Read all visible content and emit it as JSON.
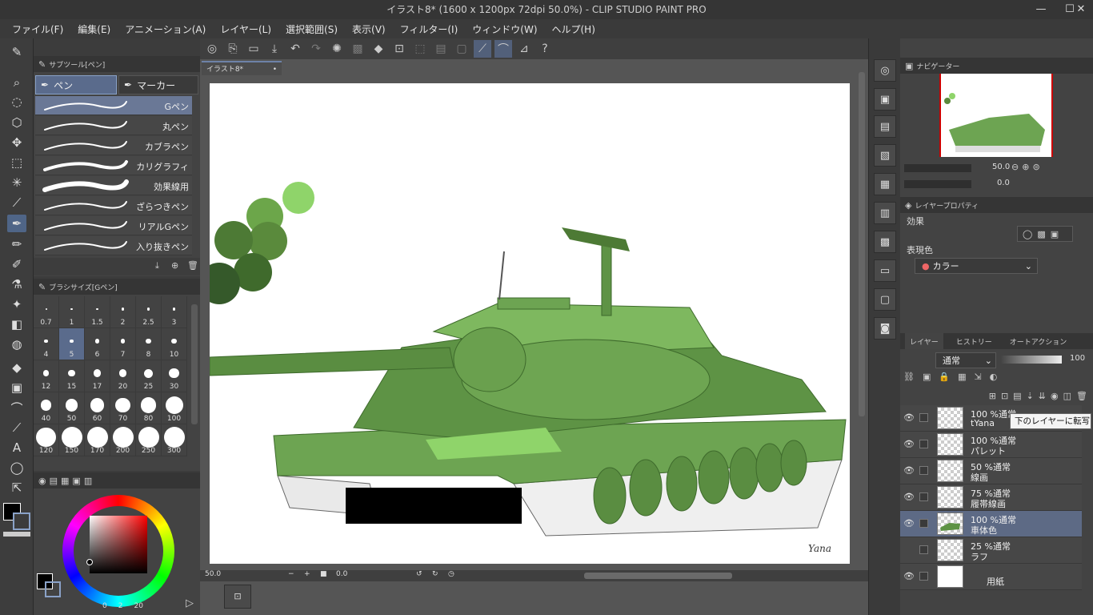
{
  "window": {
    "title": "イラスト8* (1600 x 1200px 72dpi 50.0%) - CLIP STUDIO PAINT PRO",
    "minimize_icon": "minimize-icon",
    "maximize_icon": "maximize-icon",
    "close_icon": "close-icon"
  },
  "menu": [
    "ファイル(F)",
    "編集(E)",
    "アニメーション(A)",
    "レイヤー(L)",
    "選択範囲(S)",
    "表示(V)",
    "フィルター(I)",
    "ウィンドウ(W)",
    "ヘルプ(H)"
  ],
  "subtool": {
    "header": "サブツール[ペン]",
    "categories": [
      "ペン",
      "マーカー"
    ],
    "brushes": [
      "Gペン",
      "丸ペン",
      "カブラペン",
      "カリグラフィ",
      "効果線用",
      "ざらつきペン",
      "リアルGペン",
      "入り抜きペン"
    ],
    "selected_brush": "Gペン"
  },
  "brush_size": {
    "header": "ブラシサイズ[Gペン]",
    "sizes": [
      "0.7",
      "1",
      "1.5",
      "2",
      "2.5",
      "3",
      "4",
      "5",
      "6",
      "7",
      "8",
      "10",
      "12",
      "15",
      "17",
      "20",
      "25",
      "30",
      "40",
      "50",
      "60",
      "70",
      "80",
      "100",
      "120",
      "150",
      "170",
      "200",
      "250",
      "300"
    ],
    "selected": "5"
  },
  "color": {
    "main": "#000000",
    "sub": "#ffffff",
    "accent": "#c8c8c8",
    "footer_values": [
      "0",
      "2",
      "20"
    ]
  },
  "document": {
    "tab": "イラスト8*",
    "zoom": "50.0",
    "rotation": "0.0"
  },
  "navigator": {
    "header": "ナビゲーター",
    "zoom": "50.0",
    "rotation": "0.0"
  },
  "layer_property": {
    "header": "レイヤープロパティ",
    "effect_label": "効果",
    "expression_label": "表現色",
    "expression_value": "カラー"
  },
  "layers": {
    "tabs": [
      "レイヤー",
      "ヒストリー",
      "オートアクション"
    ],
    "blend_mode": "通常",
    "opacity": "100",
    "tooltip": "下のレイヤーに転写",
    "items": [
      {
        "opacity_mode": "100 %通常",
        "name": "tYana",
        "selected": false
      },
      {
        "opacity_mode": "100 %通常",
        "name": "パレット",
        "selected": false
      },
      {
        "opacity_mode": "50 %通常",
        "name": "線画",
        "selected": false
      },
      {
        "opacity_mode": "75 %通常",
        "name": "履帯線画",
        "selected": false
      },
      {
        "opacity_mode": "100 %通常",
        "name": "車体色",
        "selected": true
      },
      {
        "opacity_mode": "25 %通常",
        "name": "ラフ",
        "selected": false
      },
      {
        "opacity_mode": "",
        "name": "用紙",
        "selected": false
      }
    ]
  },
  "canvas": {
    "signature": "Yana"
  }
}
